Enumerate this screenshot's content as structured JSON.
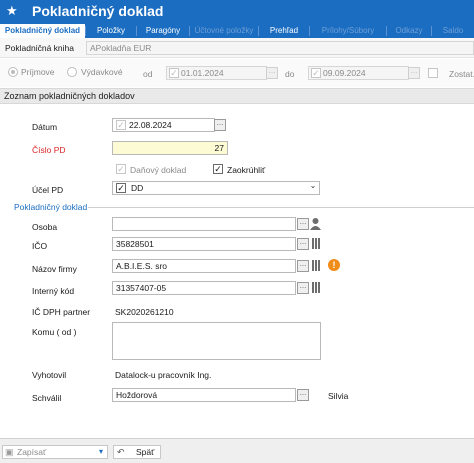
{
  "title": "Pokladničný doklad",
  "tabs": [
    {
      "label": "Pokladničný doklad",
      "state": "active"
    },
    {
      "label": "Položky",
      "state": "enabled"
    },
    {
      "label": "Paragóny",
      "state": "enabled"
    },
    {
      "label": "Účtovné položky",
      "state": "disabled"
    },
    {
      "label": "Prehľad",
      "state": "enabled"
    },
    {
      "label": "Prílohy/Súbory",
      "state": "disabled"
    },
    {
      "label": "Odkazy",
      "state": "disabled"
    },
    {
      "label": "Saldo",
      "state": "disabled"
    }
  ],
  "kniha": {
    "label": "Pokladničná kniha",
    "value": "APokladňa EUR"
  },
  "filter": {
    "prijmove": "Príjmove",
    "vydavkove": "Výdavkové",
    "od_label": "od",
    "od_value": "01.01.2024",
    "do_label": "do",
    "do_value": "09.09.2024",
    "zostatok": "Zostat..."
  },
  "section_header": "Zoznam pokladničných dokladov",
  "form": {
    "datum": {
      "label": "Dátum",
      "value": "22.08.2024"
    },
    "cislo_pd": {
      "label": "Číslo PD",
      "value": "27"
    },
    "danovy_doklad": "Daňový doklad",
    "zaokruhlit": "Zaokrúhliť",
    "ucel_pd": {
      "label": "Účel PD",
      "value": "DD"
    },
    "group_title": "Pokladničný doklad",
    "osoba": {
      "label": "Osoba",
      "value": ""
    },
    "ico": {
      "label": "IČO",
      "value": "35828501"
    },
    "nazov_firmy": {
      "label": "Názov firmy",
      "value": "A.B.I.E.S. sro"
    },
    "interny_kod": {
      "label": "Interný kód",
      "value": "31357407-05"
    },
    "ic_dph": {
      "label": "IČ DPH partner",
      "value": "SK2020261210"
    },
    "komu": {
      "label": "Komu ( od )",
      "value": ""
    },
    "vyhotovil": {
      "label": "Vyhotovil",
      "value": "Datalock-u pracovník Ing."
    },
    "schvalil": {
      "label": "Schválil",
      "value": "Hoždorová",
      "extra": "Silvia"
    }
  },
  "footer": {
    "zapisat": "Zapísať",
    "spat": "Späť"
  },
  "colors": {
    "accent": "#1b6dc1",
    "required": "#d9262a",
    "highlight": "#fdfbd4",
    "warning": "#f08c1a"
  }
}
